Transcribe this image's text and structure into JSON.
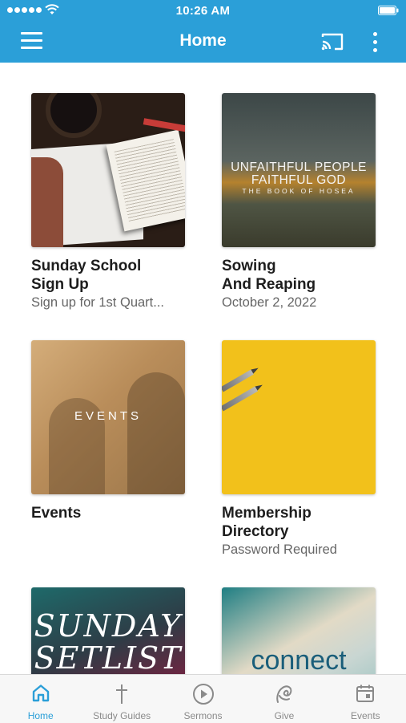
{
  "status_bar": {
    "time": "10:26 AM"
  },
  "header": {
    "title": "Home"
  },
  "cards": [
    {
      "title": "Sunday School\nSign Up",
      "subtitle": "Sign up for 1st Quart..."
    },
    {
      "title": "Sowing\nAnd Reaping",
      "subtitle": "October 2, 2022",
      "image_text": {
        "line1": "UNFAITHFUL PEOPLE",
        "line2": "FAITHFUL GOD",
        "line3": "THE BOOK OF HOSEA"
      }
    },
    {
      "title": "Events",
      "subtitle": "",
      "image_text": "EVENTS"
    },
    {
      "title": "Membership\nDirectory",
      "subtitle": "Password Required"
    },
    {
      "title": "",
      "subtitle": "",
      "image_text": {
        "line1": "SUNDAY",
        "line2": "SETLIST"
      }
    },
    {
      "title": "",
      "subtitle": "",
      "image_text": "connect"
    }
  ],
  "tabs": [
    {
      "label": "Home",
      "icon": "home-icon",
      "active": true
    },
    {
      "label": "Study Guides",
      "icon": "cross-icon",
      "active": false
    },
    {
      "label": "Sermons",
      "icon": "play-circle-icon",
      "active": false
    },
    {
      "label": "Give",
      "icon": "give-icon",
      "active": false
    },
    {
      "label": "Events",
      "icon": "calendar-icon",
      "active": false
    }
  ],
  "colors": {
    "primary": "#2b9fd8",
    "tab_inactive": "#8a8a8a",
    "tab_bar_bg": "#f7f7f7"
  }
}
